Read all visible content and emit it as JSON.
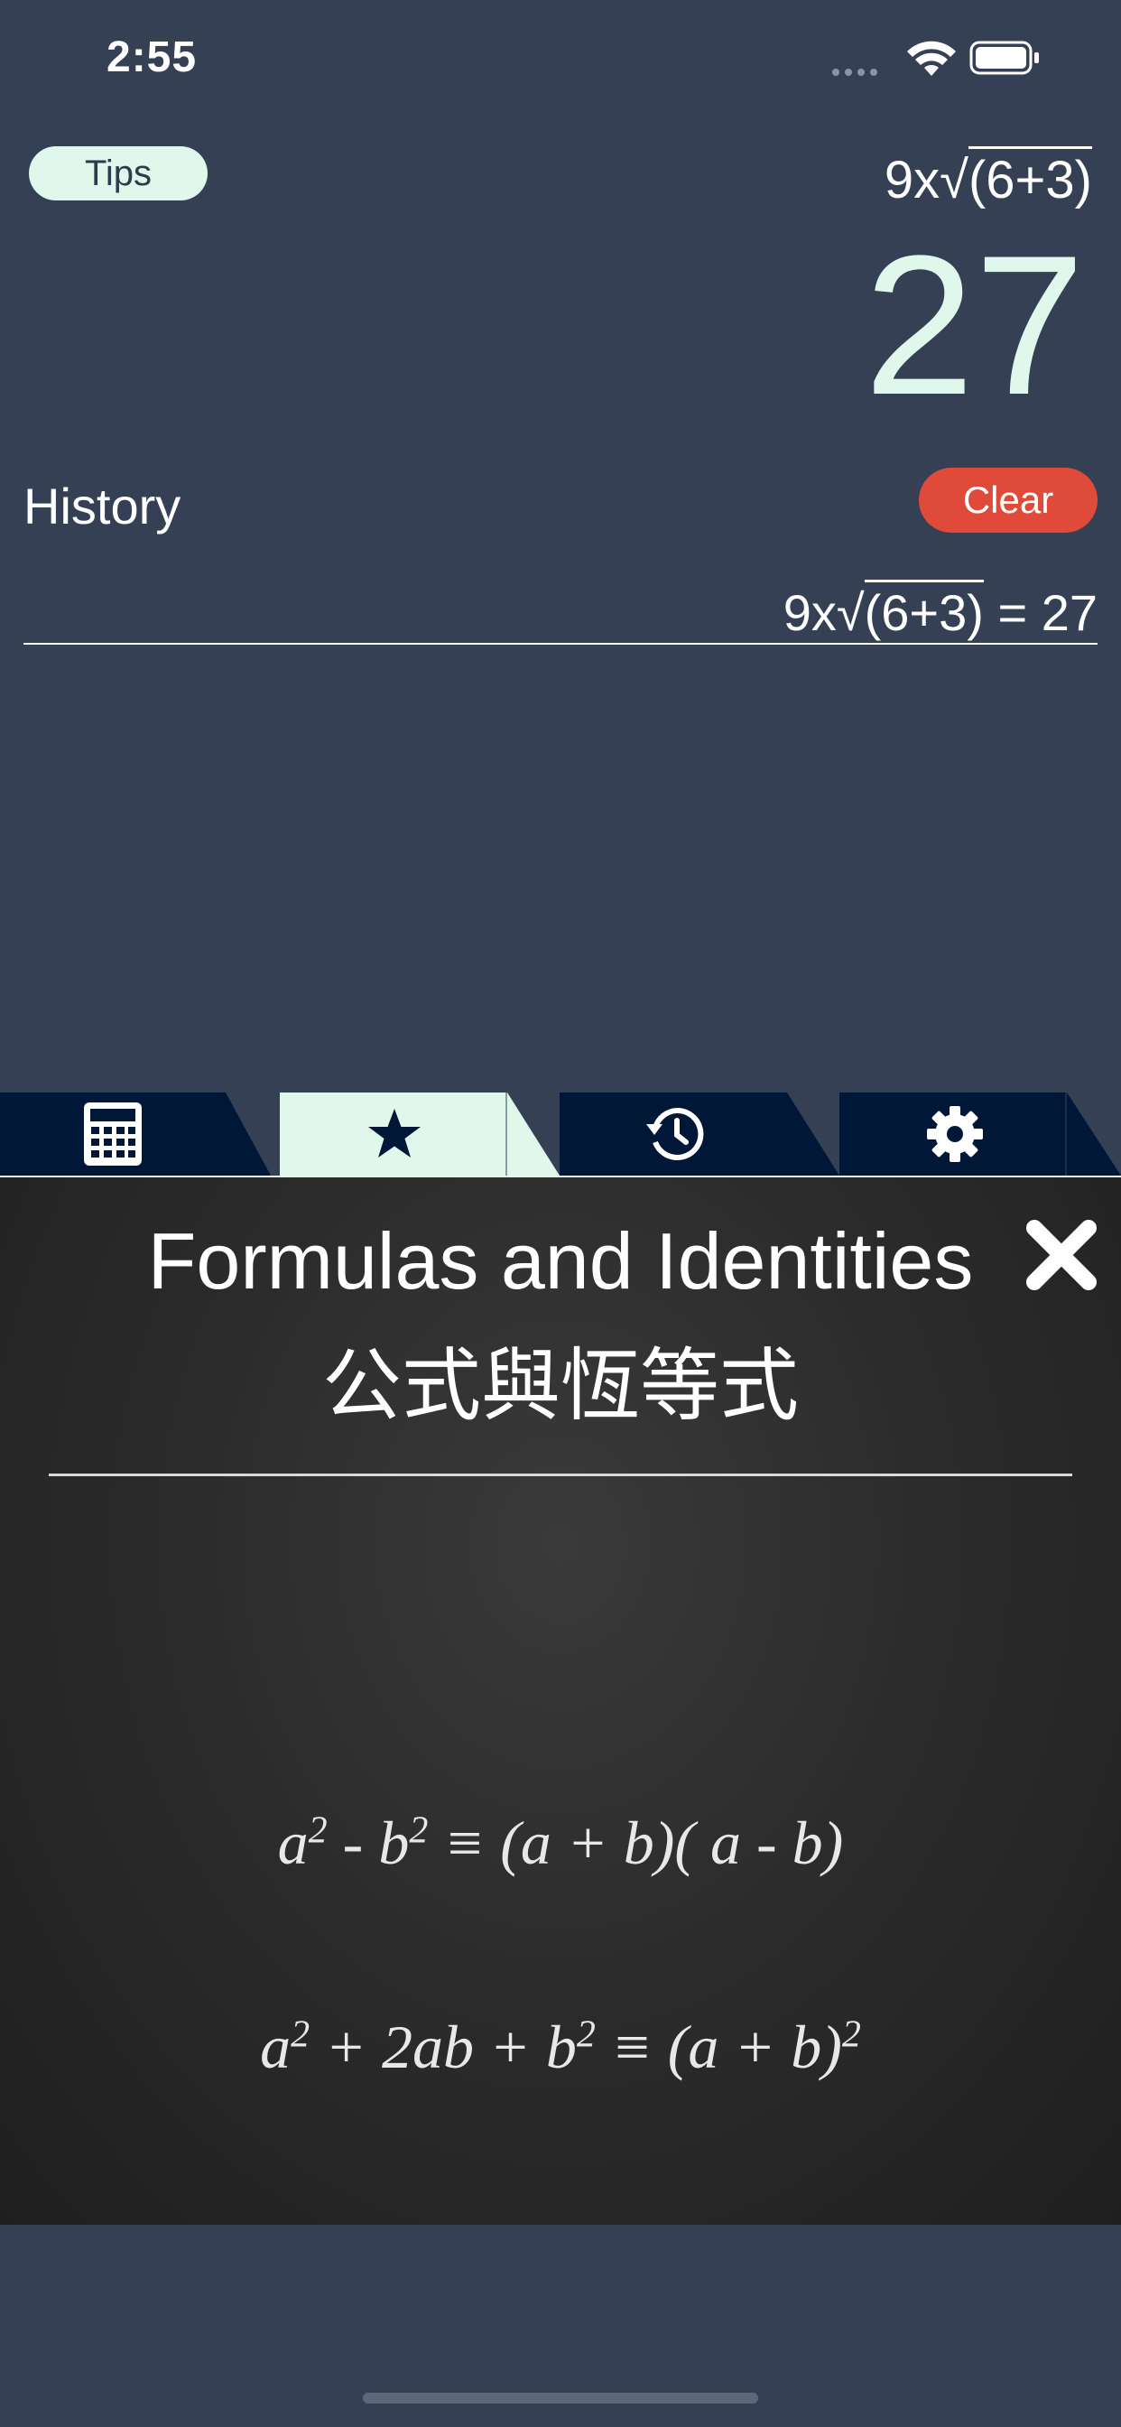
{
  "status_bar": {
    "time": "2:55"
  },
  "tips": {
    "label": "Tips"
  },
  "display": {
    "expression_prefix": "9x√",
    "expression_radicand": "(6+3)",
    "result": "27"
  },
  "history": {
    "title": "History",
    "clear_label": "Clear",
    "entries": [
      {
        "prefix": "9x√",
        "radicand": "(6+3)",
        "suffix": " = 27"
      }
    ]
  },
  "tabs": [
    {
      "icon": "calculator-icon",
      "active": false
    },
    {
      "icon": "star-icon",
      "active": true
    },
    {
      "icon": "history-icon",
      "active": false
    },
    {
      "icon": "gear-icon",
      "active": false
    }
  ],
  "board": {
    "title_en": "Formulas and Identities",
    "title_zh": "公式與恆等式"
  },
  "formulas": [
    {
      "f1_a": "a",
      "f1_a_exp": "2",
      "f1_minus": " - ",
      "f1_b": "b",
      "f1_b_exp": "2",
      "f1_rest": " ≡ (a + b)( a - b)"
    },
    {
      "f2_a": "a",
      "f2_a_exp": "2",
      "f2_mid": " + 2ab + ",
      "f2_b": "b",
      "f2_b_exp": "2",
      "f2_rest": " ≡ (a + b)",
      "f2_rest_exp": "2"
    }
  ],
  "colors": {
    "background": "#364055",
    "accent_mint": "#e0f8ec",
    "clear_red": "#e04a38",
    "tab_navy": "#001738"
  }
}
